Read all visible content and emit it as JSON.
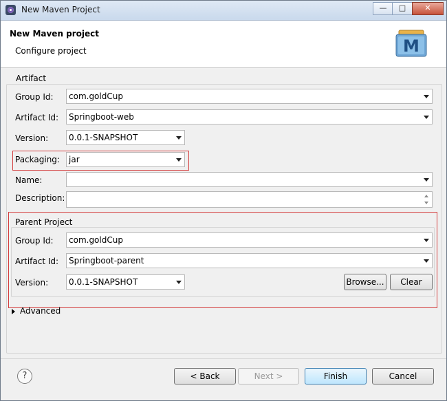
{
  "window": {
    "title": "New Maven Project",
    "controls": {
      "minimize": "—",
      "maximize": "□",
      "close": "✕"
    }
  },
  "header": {
    "title": "New Maven project",
    "subtitle": "Configure project",
    "logo_letter": "M"
  },
  "artifact": {
    "legend": "Artifact",
    "group_id_label": "Group Id:",
    "group_id": "com.goldCup",
    "artifact_id_label": "Artifact Id:",
    "artifact_id": "Springboot-web",
    "version_label": "Version:",
    "version": "0.0.1-SNAPSHOT",
    "packaging_label": "Packaging:",
    "packaging": "jar",
    "name_label": "Name:",
    "name": "",
    "description_label": "Description:",
    "description": ""
  },
  "parent": {
    "legend": "Parent Project",
    "group_id_label": "Group Id:",
    "group_id": "com.goldCup",
    "artifact_id_label": "Artifact Id:",
    "artifact_id": "Springboot-parent",
    "version_label": "Version:",
    "version": "0.0.1-SNAPSHOT",
    "browse_label": "Browse...",
    "clear_label": "Clear"
  },
  "advanced": {
    "label": "Advanced"
  },
  "footer": {
    "help": "?",
    "back_label": "< Back",
    "next_label": "Next >",
    "finish_label": "Finish",
    "cancel_label": "Cancel"
  },
  "colors": {
    "highlight": "#d33b3b",
    "primary_button": "#3c7fb1"
  }
}
